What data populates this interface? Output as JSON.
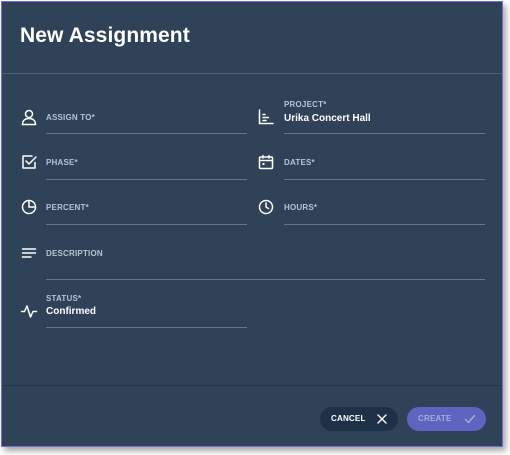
{
  "dialog": {
    "title": "New Assignment"
  },
  "fields": {
    "assign_to": {
      "label": "ASSIGN TO*",
      "value": "",
      "icon": "person-icon"
    },
    "project": {
      "label": "PROJECT*",
      "value": "Urika Concert Hall",
      "icon": "bar-chart-icon"
    },
    "phase": {
      "label": "PHASE*",
      "value": "",
      "icon": "checkbox-icon"
    },
    "dates": {
      "label": "DATES*",
      "value": "",
      "icon": "calendar-icon"
    },
    "percent": {
      "label": "PERCENT*",
      "value": "",
      "icon": "pie-chart-icon"
    },
    "hours": {
      "label": "HOURS*",
      "value": "",
      "icon": "clock-icon"
    },
    "description": {
      "label": "DESCRIPTION",
      "value": "",
      "icon": "notes-icon"
    },
    "status": {
      "label": "STATUS*",
      "value": "Confirmed",
      "icon": "activity-icon"
    }
  },
  "buttons": {
    "cancel": {
      "label": "CANCEL",
      "icon": "close-icon"
    },
    "create": {
      "label": "CREATE",
      "icon": "check-icon",
      "disabled": true
    }
  },
  "colors": {
    "background": "#2f4257",
    "primary": "#5e65c0",
    "label": "#b7c3d1",
    "value": "#ffffff",
    "underline": "#62768c"
  }
}
